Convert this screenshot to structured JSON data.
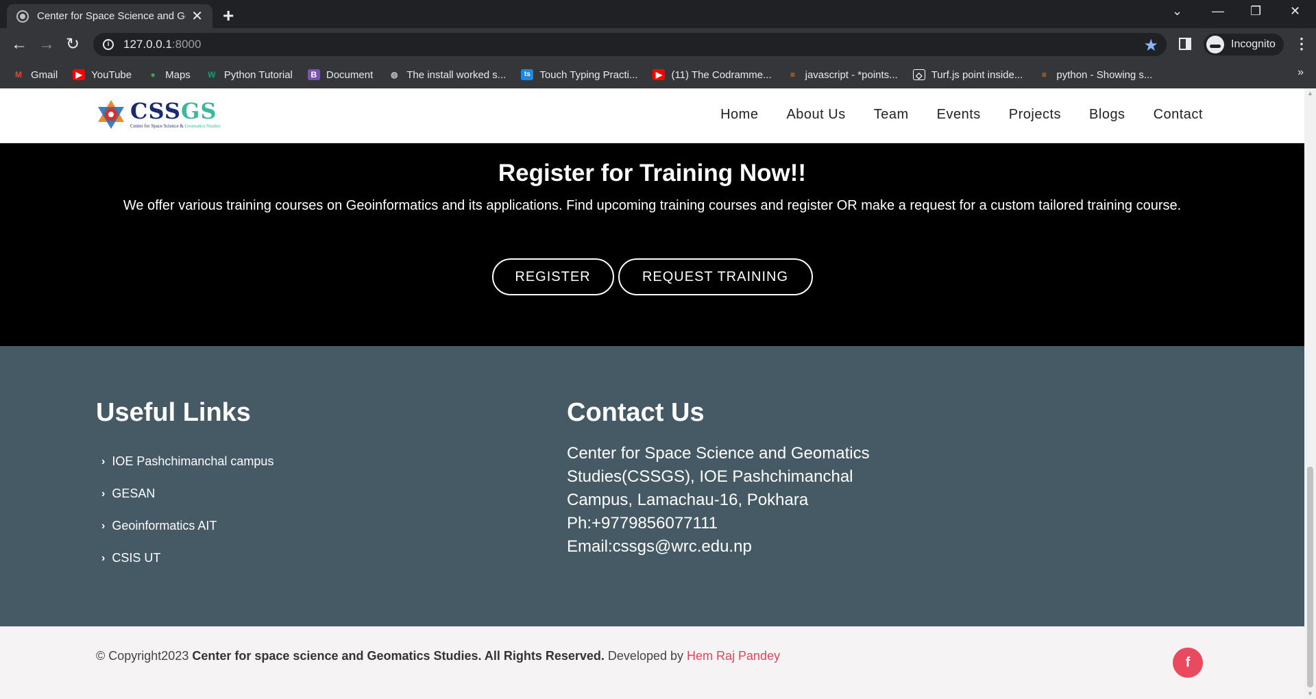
{
  "browser": {
    "tab_title": "Center for Space Science and Ge",
    "url_host": "127.0.0.1",
    "url_port": ":8000",
    "profile_label": "Incognito",
    "bookmarks": [
      {
        "label": "Gmail",
        "icon": "gmail-icon",
        "color": "#ea4335"
      },
      {
        "label": "YouTube",
        "icon": "youtube-icon",
        "color": "#ff0000"
      },
      {
        "label": "Maps",
        "icon": "maps-icon",
        "color": "#34a853"
      },
      {
        "label": "Python Tutorial",
        "icon": "w3schools-icon",
        "color": "#04aa6d"
      },
      {
        "label": "Document",
        "icon": "bootstrap-icon",
        "color": "#7952b3"
      },
      {
        "label": "The install worked s...",
        "icon": "globe-icon",
        "color": "#bdc1c6"
      },
      {
        "label": "Touch Typing Practi...",
        "icon": "typing-icon",
        "color": "#1e88e5"
      },
      {
        "label": "(11) The Codramme...",
        "icon": "youtube-icon",
        "color": "#ff0000"
      },
      {
        "label": "javascript - *points...",
        "icon": "stackoverflow-icon",
        "color": "#f48024"
      },
      {
        "label": "Turf.js point inside...",
        "icon": "codepen-icon",
        "color": "#ffffff"
      },
      {
        "label": "python - Showing s...",
        "icon": "stackoverflow-icon",
        "color": "#f48024"
      }
    ]
  },
  "site": {
    "logo_main_a": "CSS",
    "logo_main_b": "GS",
    "logo_sub_a": "Center for Space Science & ",
    "logo_sub_b": "Geomatics Studies",
    "nav": [
      "Home",
      "About Us",
      "Team",
      "Events",
      "Projects",
      "Blogs",
      "Contact"
    ]
  },
  "hero": {
    "title": "Register for Training Now!!",
    "text": "We offer various training courses on Geoinformatics and its applications. Find upcoming training courses and register OR make a request for a custom tailored training course.",
    "register_label": "REGISTER",
    "request_label": "REQUEST TRAINING"
  },
  "footer": {
    "links_title": "Useful Links",
    "links": [
      "IOE Pashchimanchal campus",
      "GESAN",
      "Geoinformatics AIT",
      "CSIS UT"
    ],
    "contact_title": "Contact Us",
    "contact_lines": [
      "Center for Space Science and Geomatics Studies(CSSGS), IOE Pashchimanchal Campus, Lamachau-16, Pokhara",
      "Ph:+9779856077111",
      "Email:cssgs@wrc.edu.np"
    ],
    "copyright_prefix": "© Copyright2023",
    "copyright_org": "Center for space science and Geomatics Studies. All Rights Reserved.",
    "developed_by": "Developed by",
    "author": "Hem Raj Pandey",
    "social_icon": "facebook-icon",
    "accent_color": "#e84a5f"
  }
}
